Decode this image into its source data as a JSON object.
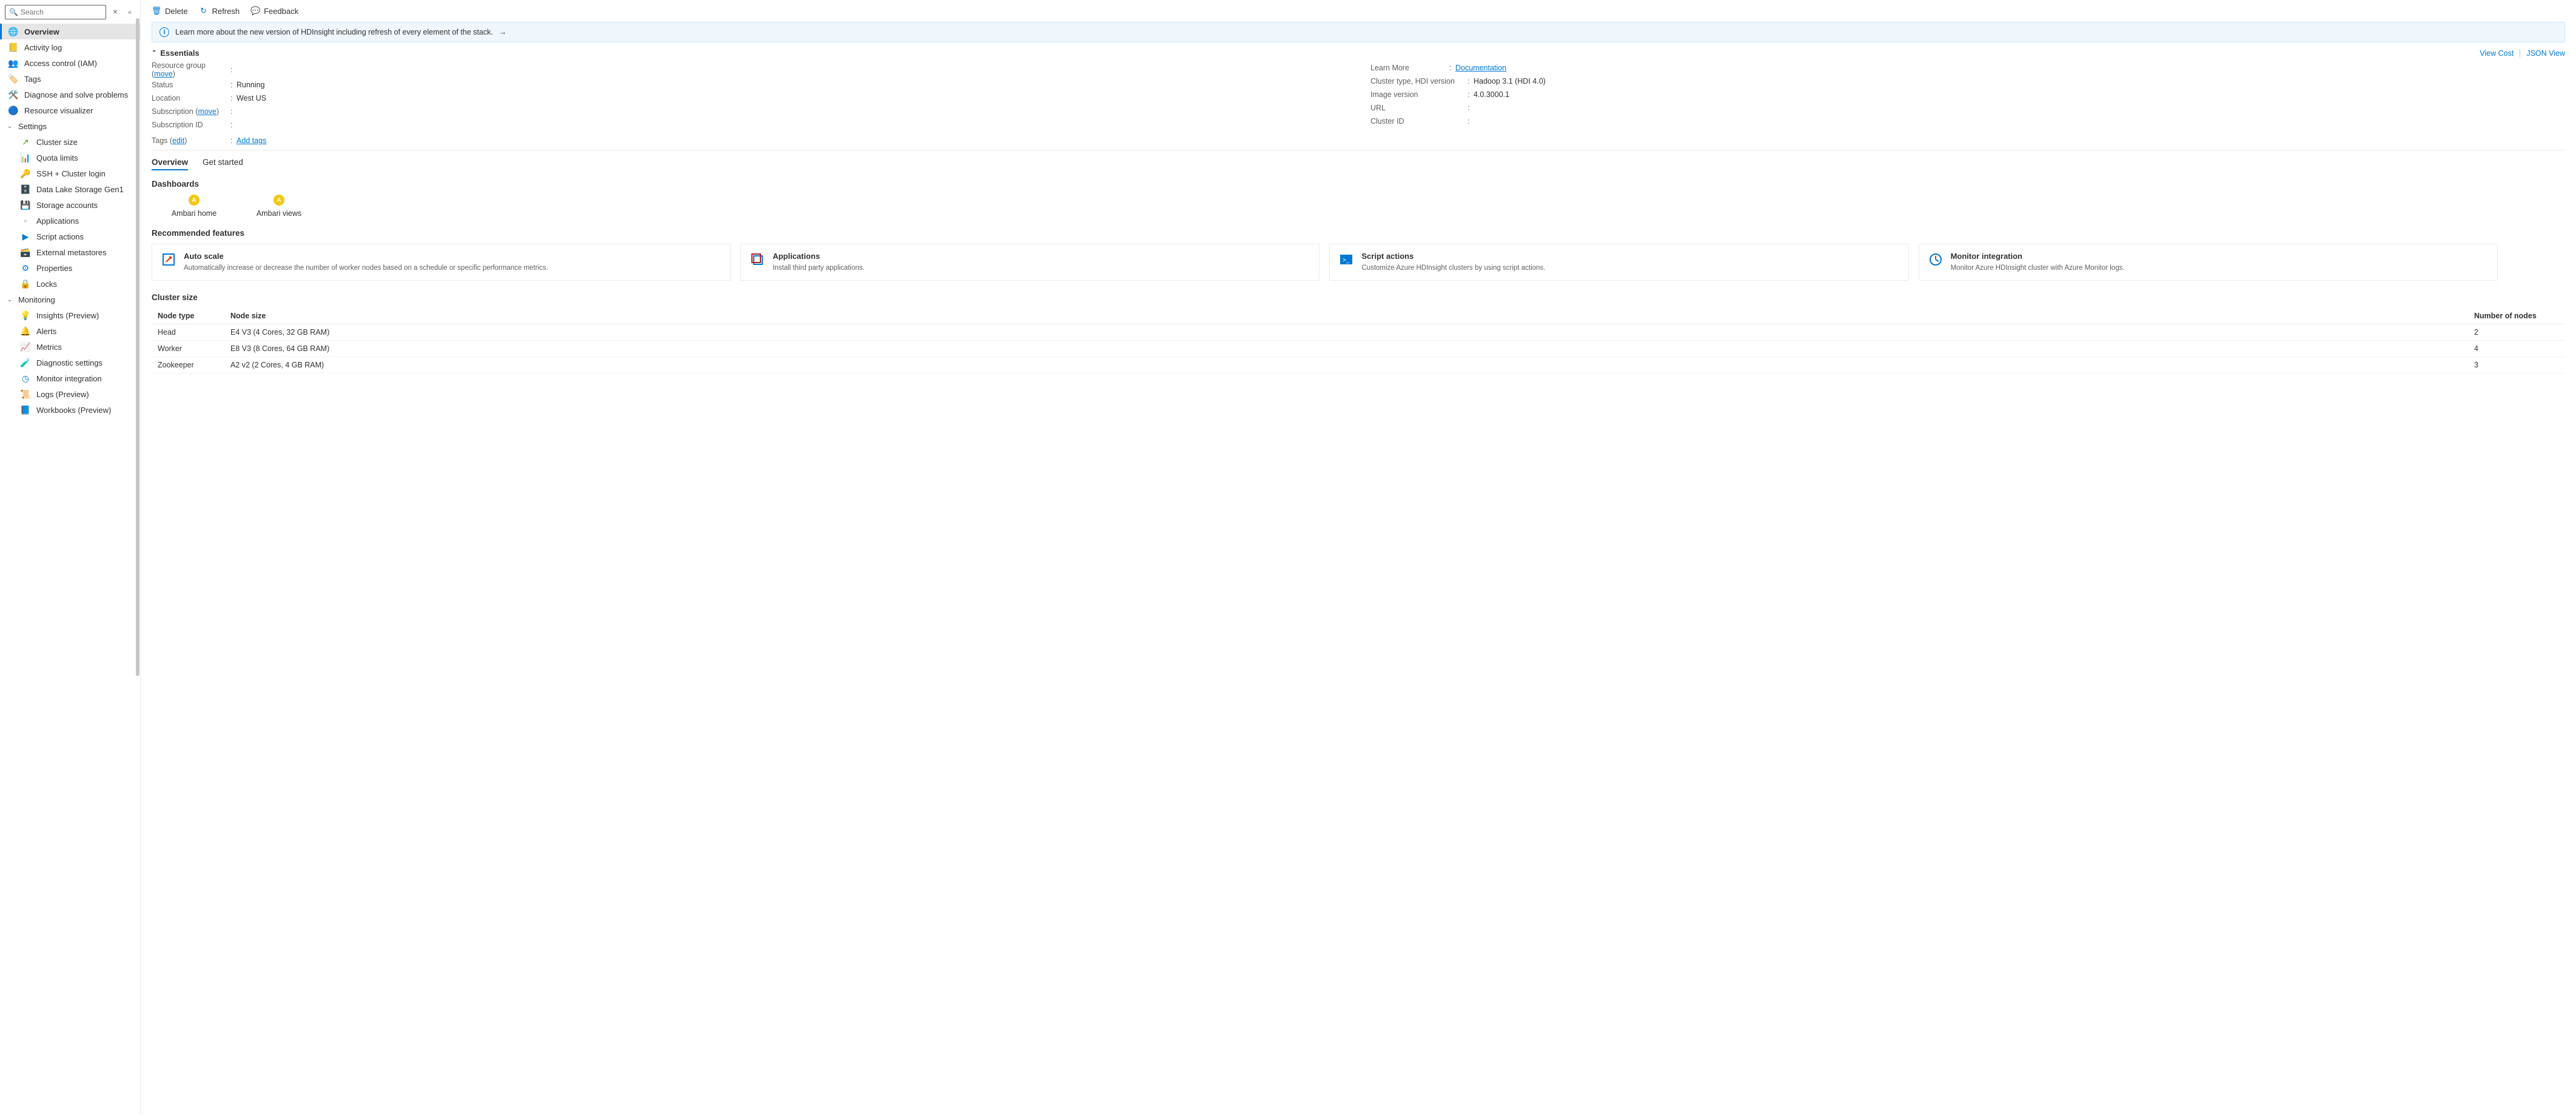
{
  "search": {
    "placeholder": "Search"
  },
  "sidebar": {
    "overview": "Overview",
    "activity": "Activity log",
    "iam": "Access control (IAM)",
    "tags": "Tags",
    "diagnose": "Diagnose and solve problems",
    "visualizer": "Resource visualizer",
    "settings_header": "Settings",
    "cluster_size": "Cluster size",
    "quota": "Quota limits",
    "ssh": "SSH + Cluster login",
    "dlg1": "Data Lake Storage Gen1",
    "storage": "Storage accounts",
    "apps": "Applications",
    "script": "Script actions",
    "ext_meta": "External metastores",
    "properties": "Properties",
    "locks": "Locks",
    "monitoring_header": "Monitoring",
    "insights": "Insights (Preview)",
    "alerts": "Alerts",
    "metrics": "Metrics",
    "diag_settings": "Diagnostic settings",
    "monitor_int": "Monitor integration",
    "logs": "Logs (Preview)",
    "workbooks": "Workbooks (Preview)"
  },
  "commands": {
    "delete": "Delete",
    "refresh": "Refresh",
    "feedback": "Feedback"
  },
  "banner": {
    "text": "Learn more about the new version of HDInsight including refresh of every element of the stack."
  },
  "essentials": {
    "title": "Essentials",
    "view_cost": "View Cost",
    "json_view": "JSON View",
    "left": {
      "rg_label": "Resource group",
      "rg_move": "move",
      "status_label": "Status",
      "status_val": "Running",
      "location_label": "Location",
      "location_val": "West US",
      "sub_label": "Subscription",
      "sub_move": "move",
      "subid_label": "Subscription ID",
      "tags_label": "Tags",
      "tags_edit": "edit",
      "add_tags": "Add tags"
    },
    "right": {
      "learn_label": "Learn More",
      "learn_val": "Documentation",
      "type_label": "Cluster type, HDI version",
      "type_val": "Hadoop 3.1 (HDI 4.0)",
      "img_label": "Image version",
      "img_val": "4.0.3000.1",
      "url_label": "URL",
      "cid_label": "Cluster ID"
    }
  },
  "tabs": {
    "overview": "Overview",
    "get_started": "Get started"
  },
  "dash": {
    "title": "Dashboards",
    "ambari_home": "Ambari home",
    "ambari_views": "Ambari views"
  },
  "rec": {
    "title": "Recommended features",
    "c1t": "Auto scale",
    "c1d": "Automatically increase or decrease the number of worker nodes based on a schedule or specific performance metrics.",
    "c2t": "Applications",
    "c2d": "Install third party applications.",
    "c3t": "Script actions",
    "c3d": "Customize Azure HDInsight clusters by using script actions.",
    "c4t": "Monitor integration",
    "c4d": "Monitor Azure HDInsight cluster with Azure Monitor logs."
  },
  "cluster": {
    "title": "Cluster size",
    "h1": "Node type",
    "h2": "Node size",
    "h3": "Number of nodes",
    "rows": [
      {
        "t": "Head",
        "s": "E4 V3 (4 Cores, 32 GB RAM)",
        "n": "2"
      },
      {
        "t": "Worker",
        "s": "E8 V3 (8 Cores, 64 GB RAM)",
        "n": "4"
      },
      {
        "t": "Zookeeper",
        "s": "A2 v2 (2 Cores, 4 GB RAM)",
        "n": "3"
      }
    ]
  }
}
